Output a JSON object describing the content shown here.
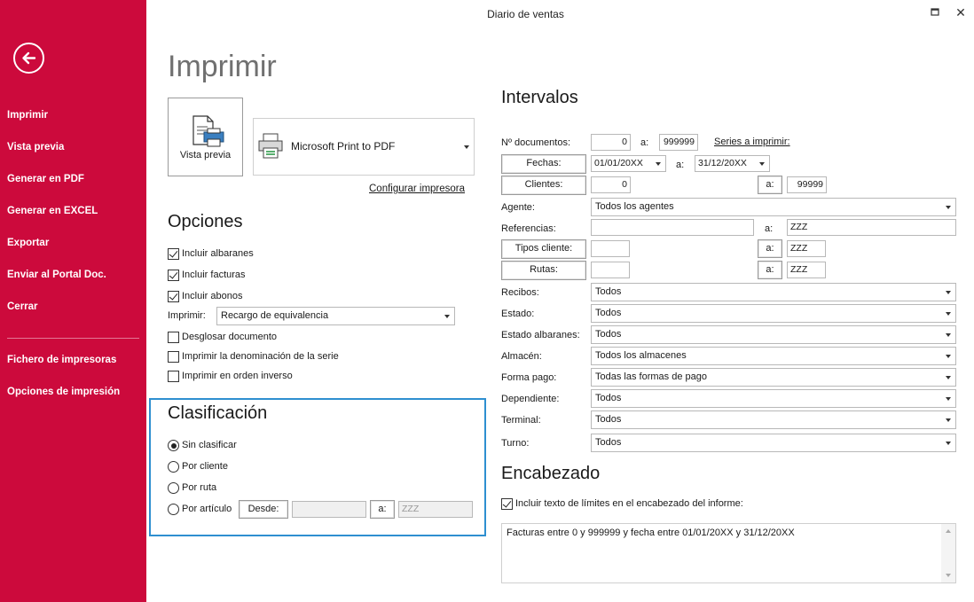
{
  "window": {
    "title": "Diario de ventas"
  },
  "sidebar": {
    "items": [
      {
        "label": "Imprimir"
      },
      {
        "label": "Vista previa"
      },
      {
        "label": "Generar en PDF"
      },
      {
        "label": "Generar en EXCEL"
      },
      {
        "label": "Exportar"
      },
      {
        "label": "Enviar al Portal Doc."
      },
      {
        "label": "Cerrar"
      },
      {
        "label": "Fichero de impresoras"
      },
      {
        "label": "Opciones de impresión"
      }
    ]
  },
  "print": {
    "title": "Imprimir",
    "preview_label": "Vista previa",
    "printer": "Microsoft Print to PDF",
    "configure_link": "Configurar impresora"
  },
  "options": {
    "title": "Opciones",
    "include_delivery_notes": "Incluir albaranes",
    "include_invoices": "Incluir facturas",
    "include_credits": "Incluir abonos",
    "print_label": "Imprimir:",
    "print_value": "Recargo de equivalencia",
    "breakdown": "Desglosar documento",
    "series_name": "Imprimir la denominación de la serie",
    "reverse_order": "Imprimir en orden inverso"
  },
  "classification": {
    "title": "Clasificación",
    "none": "Sin clasificar",
    "by_client": "Por cliente",
    "by_route": "Por ruta",
    "by_article": "Por artículo",
    "from_btn": "Desde:",
    "from_value": "",
    "to_btn": "a:",
    "to_value": "ZZZ"
  },
  "intervals": {
    "title": "Intervalos",
    "doc_label": "Nº documentos:",
    "doc_from": "0",
    "to": "a:",
    "doc_to": "999999",
    "series_link": "Series a imprimir:",
    "dates_btn": "Fechas:",
    "date_from": "01/01/20XX",
    "date_to": "31/12/20XX",
    "clients_btn": "Clientes:",
    "client_from": "0",
    "client_to": "99999",
    "agent_label": "Agente:",
    "agent_value": "Todos los agentes",
    "refs_label": "Referencias:",
    "refs_from": "",
    "refs_to": "ZZZ",
    "client_types_btn": "Tipos cliente:",
    "client_types_from": "",
    "client_types_to": "ZZZ",
    "routes_btn": "Rutas:",
    "routes_from": "",
    "routes_to": "ZZZ",
    "receipts_label": "Recibos:",
    "receipts_value": "Todos",
    "state_label": "Estado:",
    "state_value": "Todos",
    "delivery_state_label": "Estado albaranes:",
    "delivery_state_value": "Todos",
    "warehouse_label": "Almacén:",
    "warehouse_value": "Todos los almacenes",
    "payment_label": "Forma pago:",
    "payment_value": "Todas las formas de pago",
    "clerk_label": "Dependiente:",
    "clerk_value": "Todos",
    "terminal_label": "Terminal:",
    "terminal_value": "Todos",
    "shift_label": "Turno:",
    "shift_value": "Todos"
  },
  "header": {
    "title": "Encabezado",
    "include_limits": "Incluir texto de límites en el encabezado del informe:",
    "text": "Facturas entre 0 y 999999 y fecha entre 01/01/20XX y 31/12/20XX"
  },
  "colors": {
    "sidebar": "#cc0a3c",
    "focus_border": "#2e8fd0"
  }
}
